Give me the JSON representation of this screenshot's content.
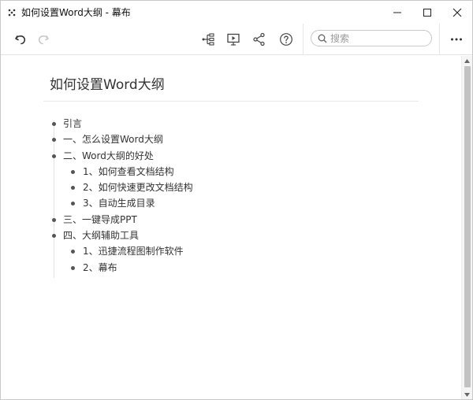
{
  "window": {
    "title": "如何设置Word大纲 - 幕布",
    "app_icon": "mubu-logo-icon",
    "controls": [
      "minimize-icon",
      "maximize-icon",
      "close-icon"
    ]
  },
  "toolbar": {
    "undo_icon": "undo-icon",
    "redo_icon": "redo-icon",
    "mindmap_icon": "mindmap-icon",
    "present_icon": "presentation-icon",
    "share_icon": "share-icon",
    "help_icon": "help-icon",
    "more_icon": "more-dots-icon",
    "search": {
      "placeholder": "搜索",
      "value": ""
    }
  },
  "document": {
    "title": "如何设置Word大纲",
    "outline": [
      {
        "level": 1,
        "text": "引言"
      },
      {
        "level": 1,
        "text": "一、怎么设置Word大纲"
      },
      {
        "level": 1,
        "text": "二、Word大纲的好处"
      },
      {
        "level": 2,
        "text": "1、如何查看文档结构"
      },
      {
        "level": 2,
        "text": "2、如何快速更改文档结构"
      },
      {
        "level": 2,
        "text": "3、自动生成目录"
      },
      {
        "level": 1,
        "text": "三、一键导成PPT"
      },
      {
        "level": 1,
        "text": "四、大纲辅助工具"
      },
      {
        "level": 2,
        "text": "1、迅捷流程图制作软件"
      },
      {
        "level": 2,
        "text": "2、幕布"
      }
    ]
  },
  "colors": {
    "text": "#333333",
    "border": "#e3e3e3",
    "scrollbar_thumb": "#c2c2c2"
  }
}
